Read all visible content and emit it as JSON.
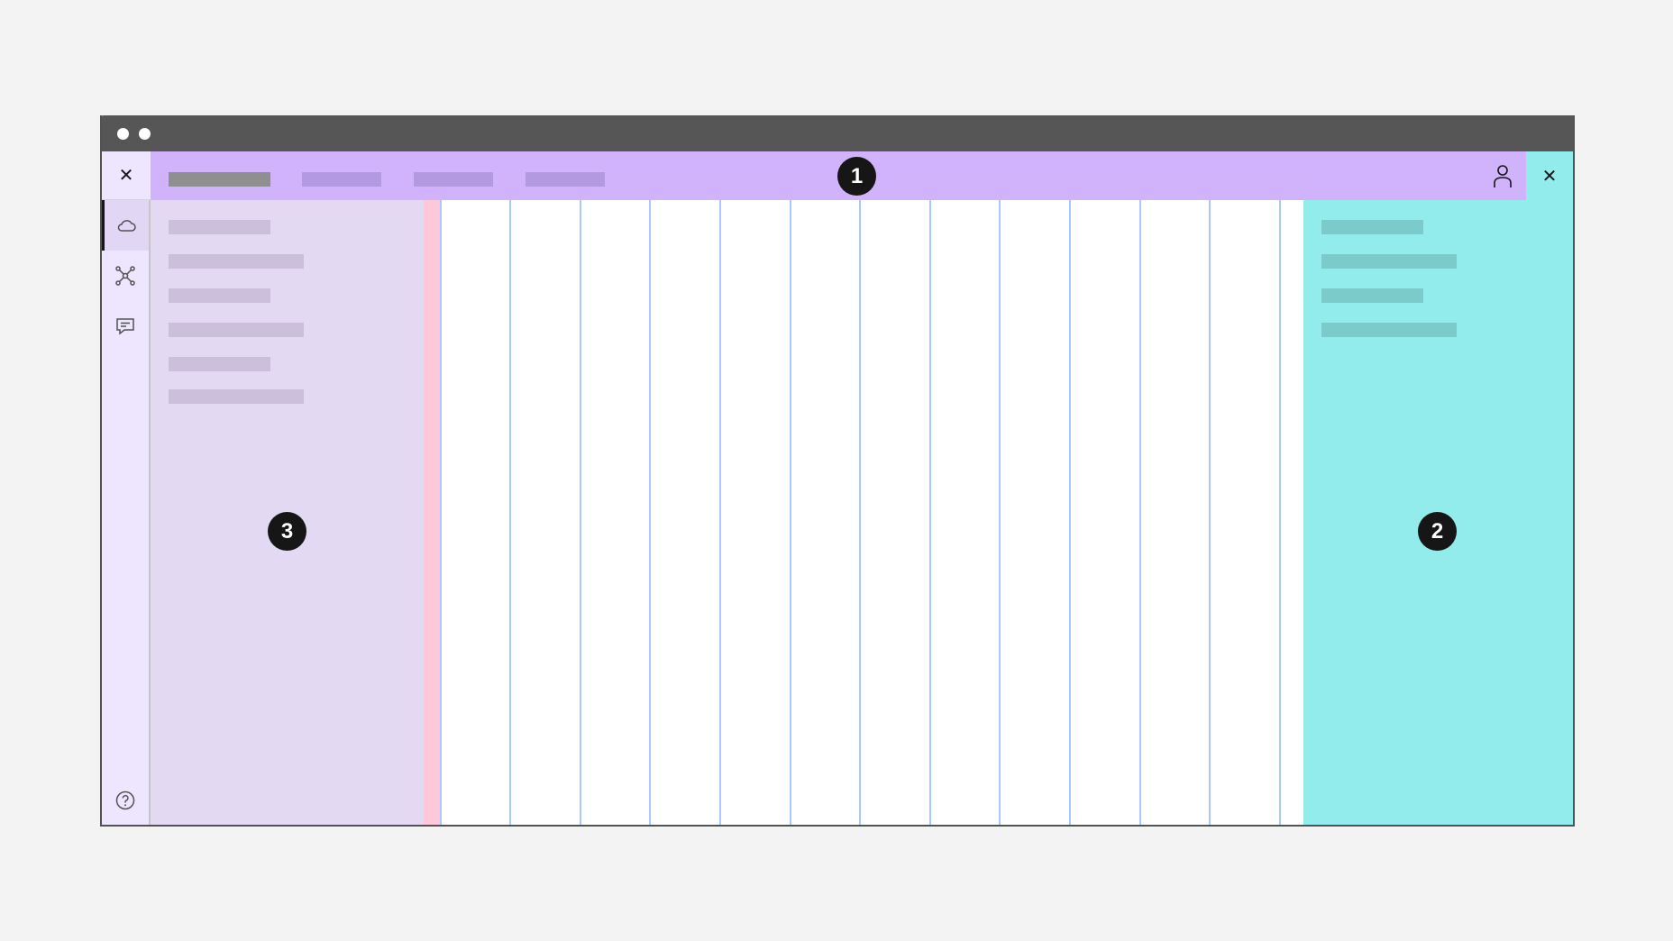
{
  "markers": {
    "header_badge": "1",
    "right_panel_badge": "2",
    "left_panel_badge": "3"
  },
  "icons": {
    "window_controls": [
      "dot",
      "dot"
    ],
    "header_close": "close-icon",
    "header_user": "user-icon",
    "right_close": "close-icon",
    "rail": [
      "cloud-icon",
      "network-icon",
      "chat-icon",
      "help-icon"
    ]
  },
  "colors": {
    "page_background": "#f3f3f3",
    "titlebar": "#565656",
    "header": "#d1b3fb",
    "rail": "#eee5ff",
    "left_panel": "#e3d9f2",
    "gutter": "#ffc7da",
    "grid_line": "#a8c8ff",
    "right_panel": "#91eceb",
    "badge": "#161616"
  }
}
